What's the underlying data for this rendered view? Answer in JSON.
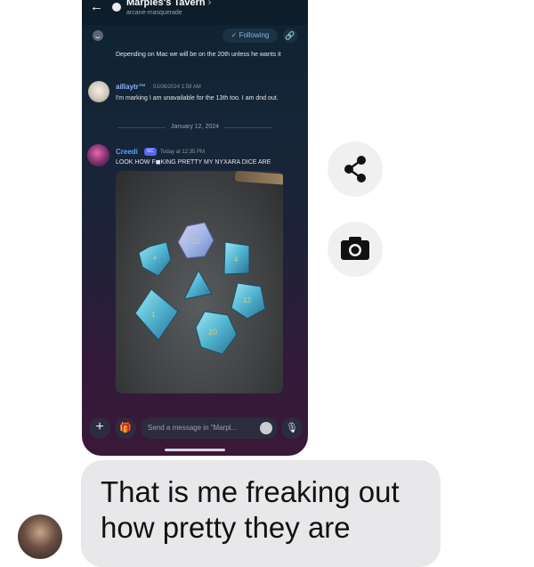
{
  "header": {
    "back_icon": "arrow-left-icon",
    "channel_icon": "chat-bubble-icon",
    "title": "Marples's Tavern",
    "chevron": "›",
    "subtitle": "arcane-masquerade"
  },
  "subbar": {
    "following_label": "Following",
    "link_icon": "link-icon"
  },
  "messages": [
    {
      "text": "Depending on Mac we will be on the 20th unless he wants it"
    },
    {
      "username": "aillaytr™",
      "timestamp": "01/06/2024 1:59 AM",
      "text": "I'm marking I am unavailable for the 13th too. I am dnd out."
    },
    {
      "date_divider": "January 12, 2024"
    },
    {
      "username": "Creedi",
      "badge": "GC",
      "timestamp": "Today at 12:35 PM",
      "text": "LOOK HOW F◼KING PRETTY MY NYXARA DICE ARE"
    }
  ],
  "composer": {
    "placeholder": "Send a message in \"Marpl...",
    "plus_label": "+",
    "gift_icon": "gift-icon",
    "mic_icon": "mic-icon"
  },
  "side_buttons": {
    "share_icon": "share-icon",
    "camera_icon": "camera-icon"
  },
  "reply": {
    "text_line1": "That is me freaking out",
    "text_line2": "how pretty they are"
  },
  "colors": {
    "accent_blue": "#5ea4ea",
    "user1_color": "#8ab4f8",
    "user2_color": "#5aa0ff"
  }
}
